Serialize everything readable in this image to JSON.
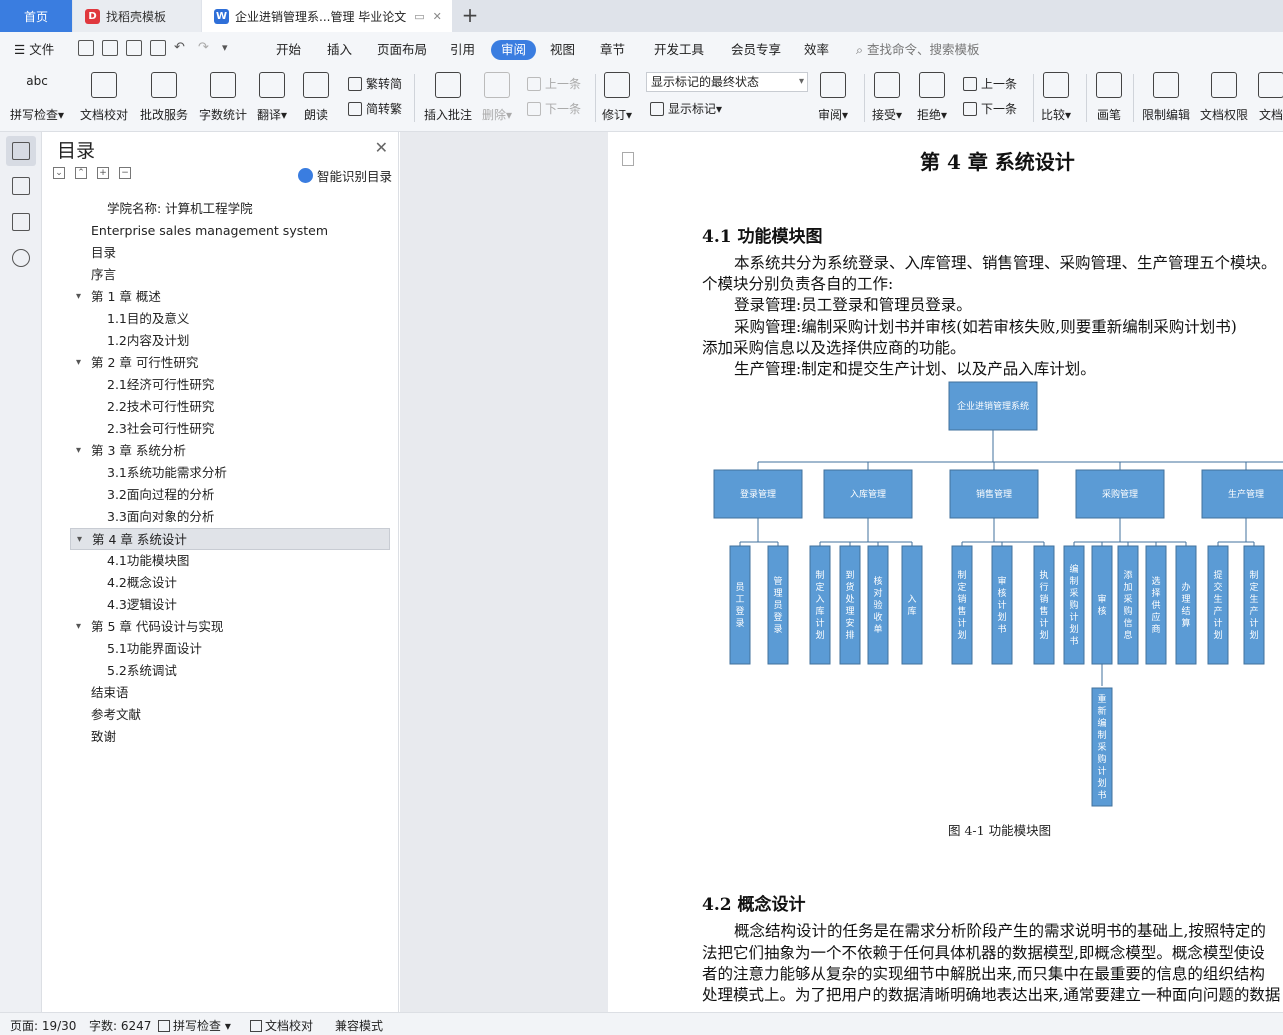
{
  "tabs": {
    "home": "首页",
    "daoke": "找稻壳模板",
    "doc": "企业进销管理系...管理 毕业论文",
    "plus": "+"
  },
  "menu": {
    "file": "文件",
    "items": [
      "开始",
      "插入",
      "页面布局",
      "引用",
      "审阅",
      "视图",
      "章节",
      "开发工具",
      "会员专享",
      "效率"
    ],
    "active": "审阅",
    "search": "查找命令、搜索模板"
  },
  "ribbon": {
    "spell": "拼写检查",
    "doccheck": "文档校对",
    "batch": "批改服务",
    "wordcount": "字数统计",
    "translate": "翻译",
    "read": "朗读",
    "trad": "繁转简",
    "simp": "简转繁",
    "insert_comment": "插入批注",
    "delete": "删除",
    "prev": "上一条",
    "next": "下一条",
    "revise": "修订",
    "markup_state": "显示标记的最终状态",
    "show_markup": "显示标记",
    "review": "审阅",
    "accept": "接受",
    "reject": "拒绝",
    "prev2": "上一条",
    "next2": "下一条",
    "compare": "比较",
    "pen": "画笔",
    "restrict": "限制编辑",
    "doc_perm": "文档权限",
    "doc_more": "文档"
  },
  "toc": {
    "title": "目录",
    "smart": "智能识别目录",
    "items": [
      {
        "label": "学院名称:   计算机工程学院",
        "level": 3
      },
      {
        "label": "Enterprise sales management system",
        "level": 2
      },
      {
        "label": "目录",
        "level": 2
      },
      {
        "label": "序言",
        "level": 2
      },
      {
        "label": "第 1 章  概述",
        "level": 1
      },
      {
        "label": "1.1目的及意义",
        "level": 3
      },
      {
        "label": "1.2内容及计划",
        "level": 3
      },
      {
        "label": "第 2 章  可行性研究",
        "level": 1
      },
      {
        "label": "2.1经济可行性研究",
        "level": 3
      },
      {
        "label": "2.2技术可行性研究",
        "level": 3
      },
      {
        "label": "2.3社会可行性研究",
        "level": 3
      },
      {
        "label": "第 3 章  系统分析",
        "level": 1
      },
      {
        "label": "3.1系统功能需求分析",
        "level": 3
      },
      {
        "label": "3.2面向过程的分析",
        "level": 3
      },
      {
        "label": "3.3面向对象的分析",
        "level": 3
      },
      {
        "label": "第 4 章  系统设计",
        "level": 1
      },
      {
        "label": "4.1功能模块图",
        "level": 3
      },
      {
        "label": "4.2概念设计",
        "level": 3
      },
      {
        "label": "4.3逻辑设计",
        "level": 3
      },
      {
        "label": "第 5 章  代码设计与实现",
        "level": 1
      },
      {
        "label": "5.1功能界面设计",
        "level": 3
      },
      {
        "label": "5.2系统调试",
        "level": 3
      },
      {
        "label": "结束语",
        "level": 2
      },
      {
        "label": "参考文献",
        "level": 2
      },
      {
        "label": "致谢",
        "level": 2
      }
    ],
    "selected_index": 15
  },
  "doc": {
    "chapter_title": "第 4 章    系统设计",
    "sec1_title": "4.1    功能模块图",
    "p1a": "本系统共分为系统登录、入库管理、销售管理、采购管理、生产管理五个模块。",
    "p1b": "个模块分别负责各自的工作:",
    "p2": "登录管理:员工登录和管理员登录。",
    "p3a": "采购管理:编制采购计划书并审核(如若审核失败,则要重新编制采购计划书)",
    "p3b": "添加采购信息以及选择供应商的功能。",
    "p4": "生产管理:制定和提交生产计划、以及产品入库计划。",
    "diagram": {
      "root": "企业进销管理系统",
      "modules": [
        "登录管理",
        "入库管理",
        "销售管理",
        "采购管理",
        "生产管理"
      ],
      "leaves": [
        "员工登录",
        "管理员登录",
        "制定入库计划",
        "到货处理安排",
        "核对验收单",
        "入库",
        "制定销售计划",
        "审核计划书",
        "执行销售计划",
        "编制采购计划书",
        "审核",
        "添加采购信息",
        "选择供应商",
        "办理结算",
        "提交生产计划",
        "制定生产计划"
      ],
      "extra": "重新编制采购计划书"
    },
    "caption": "图 4-1  功能模块图",
    "sec2_title": "4.2    概念设计",
    "p5": "概念结构设计的任务是在需求分析阶段产生的需求说明书的基础上,按照特定的",
    "p6": "法把它们抽象为一个不依赖于任何具体机器的数据模型,即概念模型。概念模型使设",
    "p7": "者的注意力能够从复杂的实现细节中解脱出来,而只集中在最重要的信息的组织结构",
    "p8": "处理模式上。为了把用户的数据清晰明确地表达出来,通常要建立一种面向问题的数据"
  },
  "status": {
    "page": "页面: 19/30",
    "words": "字数: 6247",
    "spell": "拼写检查",
    "doccheck": "文档校对",
    "compat": "兼容模式"
  },
  "colors": {
    "accent": "#3a7de0",
    "box_fill": "#5b9bd5",
    "box_stroke": "#41719c"
  }
}
